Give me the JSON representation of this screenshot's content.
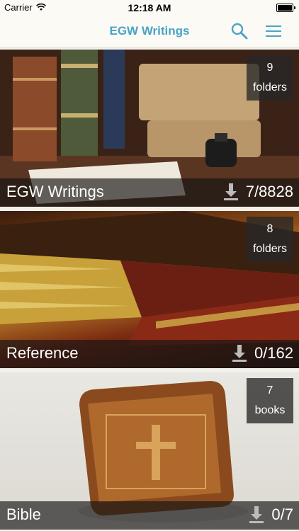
{
  "status": {
    "carrier": "Carrier",
    "time": "12:18 AM"
  },
  "nav": {
    "title": "EGW Writings",
    "icons": [
      "search-icon",
      "menu-icon"
    ],
    "accent": "#4ba3c8"
  },
  "tiles": [
    {
      "name": "EGW Writings",
      "count": "9",
      "unit": "folders",
      "downloads": "7/8828"
    },
    {
      "name": "Reference",
      "count": "8",
      "unit": "folders",
      "downloads": "0/162"
    },
    {
      "name": "Bible",
      "count": "7",
      "unit": "books",
      "downloads": "0/7"
    }
  ]
}
